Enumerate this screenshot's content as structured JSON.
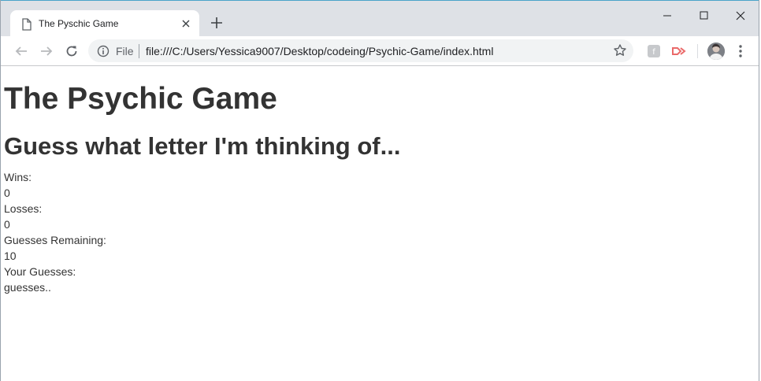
{
  "browser": {
    "tab_title": "The Pyschic Game",
    "scheme_label": "File",
    "url": "file:///C:/Users/Yessica9007/Desktop/codeing/Psychic-Game/index.html",
    "accent": "#4aa3c9"
  },
  "icons": {
    "tab": "file-icon",
    "close": "close-icon",
    "new_tab": "plus-icon",
    "back": "back-arrow-icon",
    "forward": "forward-arrow-icon",
    "reload": "reload-icon",
    "info": "info-icon",
    "bookmark": "star-icon",
    "menu": "menu-dots-icon"
  },
  "page": {
    "title": "The Psychic Game",
    "subtitle": "Guess what letter I'm thinking of...",
    "wins_label": "Wins:",
    "wins_value": "0",
    "losses_label": "Losses:",
    "losses_value": "0",
    "remaining_label": "Guesses Remaining:",
    "remaining_value": "10",
    "guesses_label": "Your Guesses:",
    "guesses_value": "guesses.."
  }
}
